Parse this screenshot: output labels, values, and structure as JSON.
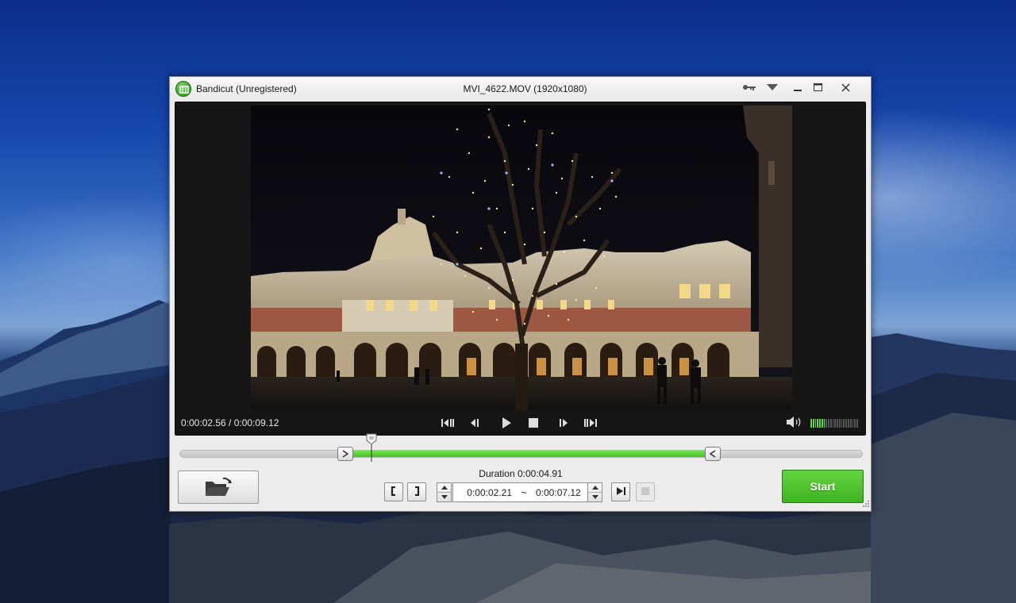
{
  "window": {
    "app_title": "Bandicut (Unregistered)",
    "file_title": "MVI_4622.MOV (1920x1080)",
    "icons": {
      "app": "bandicut-logo-icon",
      "key": "key-icon",
      "menu": "dropdown-arrow-icon",
      "minimize": "minimize-icon",
      "maximize": "maximize-icon",
      "close": "close-icon"
    }
  },
  "player": {
    "time_readout": "0:00:02.56 / 0:00:09.12",
    "controls": [
      "previous-keyframe-icon",
      "step-back-icon",
      "play-icon",
      "stop-icon",
      "step-forward-icon",
      "next-keyframe-icon"
    ],
    "volume_icon": "speaker-icon",
    "volume_level": 0.3
  },
  "timeline": {
    "total_seconds": 9.12,
    "current_seconds": 2.56,
    "selection_start_seconds": 2.21,
    "selection_end_seconds": 7.12,
    "selection_color": "#4cc12a"
  },
  "trim": {
    "duration_label": "Duration 0:00:04.91",
    "start_time": "0:00:02.21",
    "separator": "~",
    "end_time": "0:00:07.12",
    "icons": {
      "open": "folder-open-icon",
      "set_start": "bracket-start-icon",
      "set_end": "bracket-end-icon",
      "play_segment": "play-segment-icon",
      "stop_segment": "stop-segment-icon"
    },
    "start_button_label": "Start",
    "start_button_color": "#3fb323"
  }
}
